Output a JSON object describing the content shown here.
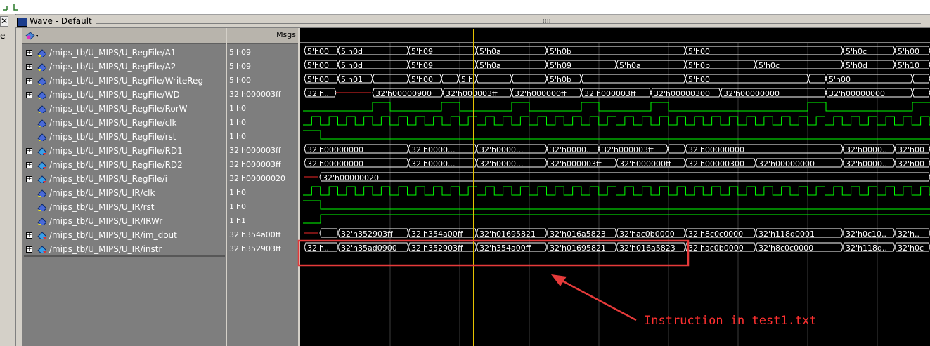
{
  "app": {
    "window_title": "Wave - Default",
    "left_close": "✕",
    "left_stub": "e"
  },
  "header": {
    "msgs_label": "Msgs"
  },
  "colors": {
    "wave": "#00ff00",
    "cursor": "#e6c100",
    "grid": "#3c3c3c",
    "highlight": "#e53a3a",
    "text": "#ffffff"
  },
  "signals": [
    {
      "name": "/mips_tb/U_MIPS/U_RegFile/A1",
      "value": "5'h09",
      "bus": true,
      "kind": "in",
      "segs": [
        [
          433,
          "5'h00"
        ],
        [
          481,
          "5'h0d"
        ],
        [
          581,
          "5'h09"
        ],
        [
          678,
          "5'h0a"
        ],
        [
          778,
          "5'h0b"
        ],
        [
          975,
          "5'h00"
        ],
        [
          1199,
          "5'h0c"
        ],
        [
          1273,
          "5'h00"
        ]
      ]
    },
    {
      "name": "/mips_tb/U_MIPS/U_RegFile/A2",
      "value": "5'h09",
      "bus": true,
      "kind": "in",
      "segs": [
        [
          433,
          "5'h00"
        ],
        [
          481,
          "5'h0d"
        ],
        [
          581,
          "5'h09"
        ],
        [
          678,
          "5'h0a"
        ],
        [
          778,
          "5'h09"
        ],
        [
          877,
          "5'h0a"
        ],
        [
          975,
          "5'h0b"
        ],
        [
          1075,
          "5'h0c"
        ],
        [
          1199,
          "5'h0d"
        ],
        [
          1273,
          "5'h10"
        ]
      ]
    },
    {
      "name": "/mips_tb/U_MIPS/U_RegFile/WriteReg",
      "value": "5'h00",
      "bus": true,
      "kind": "in",
      "segs": [
        [
          433,
          "5'h00"
        ],
        [
          481,
          "5'h01"
        ],
        [
          530,
          ""
        ],
        [
          581,
          "5'h00"
        ],
        [
          628,
          ""
        ],
        [
          652,
          "5'h00"
        ],
        [
          678,
          ""
        ],
        [
          728,
          ""
        ],
        [
          778,
          "5'h0b"
        ],
        [
          827,
          ""
        ],
        [
          975,
          "5'h00"
        ],
        [
          1150,
          ""
        ],
        [
          1175,
          "5'h00"
        ],
        [
          1298,
          ""
        ]
      ]
    },
    {
      "name": "/mips_tb/U_MIPS/U_RegFile/WD",
      "value": "32'h000003ff",
      "bus": true,
      "kind": "in",
      "segs": [
        [
          433,
          "32'h..."
        ],
        [
          478,
          "~"
        ],
        [
          530,
          "32'h00000900"
        ],
        [
          630,
          "32'h000003ff"
        ],
        [
          728,
          "32'h000000ff"
        ],
        [
          827,
          "32'h000003ff"
        ],
        [
          926,
          "32'h00000300"
        ],
        [
          1025,
          "32'h00000000"
        ],
        [
          1175,
          "32'h00000000"
        ],
        [
          1298,
          ""
        ]
      ]
    },
    {
      "name": "/mips_tb/U_MIPS/U_RegFile/RorW",
      "value": "1'h0",
      "bus": false,
      "kind": "in",
      "edges": [
        431,
        530,
        555,
        628,
        654,
        728,
        753,
        827,
        852,
        926,
        951,
        1149,
        1175,
        1298,
        1323
      ],
      "start": 0
    },
    {
      "name": "/mips_tb/U_MIPS/U_RegFile/clk",
      "value": "1'h0",
      "bus": false,
      "kind": "in",
      "clock": true
    },
    {
      "name": "/mips_tb/U_MIPS/U_RegFile/rst",
      "value": "1'h0",
      "bus": false,
      "kind": "in",
      "edges": [
        431,
        456,
        1323
      ],
      "start": 1
    },
    {
      "name": "/mips_tb/U_MIPS/U_RegFile/RD1",
      "value": "32'h000003ff",
      "bus": true,
      "kind": "out",
      "segs": [
        [
          433,
          "32'h00000000"
        ],
        [
          581,
          "32'h0000..."
        ],
        [
          678,
          "32'h0000..."
        ],
        [
          778,
          "32'h0000..."
        ],
        [
          852,
          "32'h000003ff"
        ],
        [
          950,
          ""
        ],
        [
          975,
          "32'h00000000"
        ],
        [
          1199,
          "32'h0000..."
        ],
        [
          1273,
          "32'h0000"
        ]
      ]
    },
    {
      "name": "/mips_tb/U_MIPS/U_RegFile/RD2",
      "value": "32'h000003ff",
      "bus": true,
      "kind": "out",
      "segs": [
        [
          433,
          "32'h00000000"
        ],
        [
          581,
          "32'h0000..."
        ],
        [
          678,
          "32'h0000..."
        ],
        [
          778,
          "32'h000003ff"
        ],
        [
          877,
          "32'h000000ff"
        ],
        [
          975,
          "32'h00000300"
        ],
        [
          1075,
          "32'h00000000"
        ],
        [
          1199,
          "32'h0000..."
        ],
        [
          1273,
          "32'h0000"
        ]
      ]
    },
    {
      "name": "/mips_tb/U_MIPS/U_RegFile/i",
      "value": "32'h00000020",
      "bus": true,
      "kind": "out",
      "segs": [
        [
          433,
          "~"
        ],
        [
          455,
          "32'h00000020"
        ],
        [
          1323,
          "|"
        ]
      ]
    },
    {
      "name": "/mips_tb/U_MIPS/U_IR/clk",
      "value": "1'h0",
      "bus": false,
      "kind": "in",
      "clock": true
    },
    {
      "name": "/mips_tb/U_MIPS/U_IR/rst",
      "value": "1'h0",
      "bus": false,
      "kind": "in",
      "edges": [
        431,
        456,
        1323
      ],
      "start": 1
    },
    {
      "name": "/mips_tb/U_MIPS/U_IR/IRWr",
      "value": "1'h1",
      "bus": false,
      "kind": "in",
      "edges": [
        431,
        456,
        1323
      ],
      "start": 0
    },
    {
      "name": "/mips_tb/U_MIPS/U_IR/im_dout",
      "value": "32'h354a00ff",
      "bus": true,
      "kind": "out",
      "segs": [
        [
          433,
          "~"
        ],
        [
          455,
          ""
        ],
        [
          481,
          "32'h352903ff"
        ],
        [
          581,
          "32'h354a00ff"
        ],
        [
          678,
          "32'h01695821"
        ],
        [
          778,
          "32'h016a5823"
        ],
        [
          877,
          "32'hac0b0000"
        ],
        [
          975,
          "32'h8c0c0000"
        ],
        [
          1075,
          "32'h118d0001"
        ],
        [
          1199,
          "32'h0c10..."
        ],
        [
          1273,
          "32'h..."
        ]
      ]
    },
    {
      "name": "/mips_tb/U_MIPS/U_IR/instr",
      "value": "32'h352903ff",
      "bus": true,
      "kind": "out",
      "segs": [
        [
          433,
          "32'h..."
        ],
        [
          481,
          "32'h35ad0900"
        ],
        [
          581,
          "32'h352903ff"
        ],
        [
          678,
          "32'h354a00ff"
        ],
        [
          778,
          "32'h01695821"
        ],
        [
          877,
          "32'h016a5823"
        ],
        [
          975,
          "32'hac0b0000"
        ],
        [
          1075,
          "32'h8c0c0000"
        ],
        [
          1199,
          "32'h118d..."
        ],
        [
          1273,
          "32'h0c1"
        ]
      ]
    }
  ],
  "annotation": {
    "text": "Instruction in test1.txt"
  }
}
